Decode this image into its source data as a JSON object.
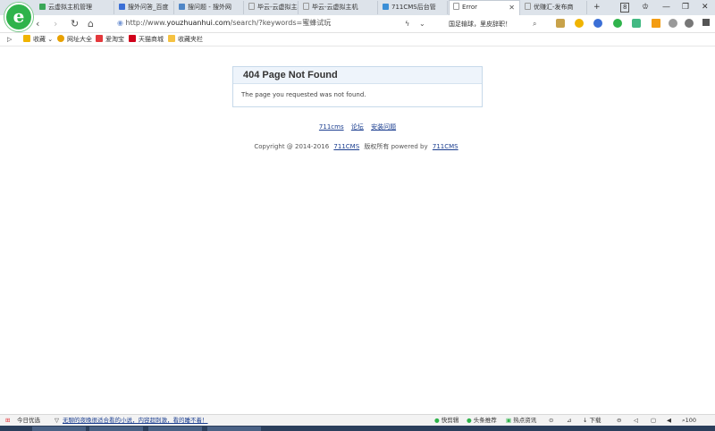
{
  "tabs": [
    {
      "label": "云虚拟主机管理",
      "active": false,
      "color": "#3aa757"
    },
    {
      "label": "搜外问答_百度",
      "active": false,
      "color": "#3b6fd6"
    },
    {
      "label": "搜问题 - 搜外网",
      "active": false,
      "color": "#4f86c6"
    },
    {
      "label": "毕云-云虚拟主机",
      "active": false,
      "color": "#888888"
    },
    {
      "label": "毕云-云虚拟主机",
      "active": false,
      "color": "#888888"
    },
    {
      "label": "711CMS后台管",
      "active": false,
      "color": "#3b8fd6"
    },
    {
      "label": "Error",
      "active": true,
      "color": "#999999"
    },
    {
      "label": "优赚汇-发布商",
      "active": false,
      "color": "#888888"
    }
  ],
  "tab_count": "8",
  "address": {
    "prefix": "http://www.",
    "domain": "youzhuanhui.com",
    "path": "/search/?keywords=蜜蜂试玩"
  },
  "news_ticker": "国足输球，里皮辞职！",
  "bookmarks": [
    {
      "label": "收藏",
      "color": "#f0b400"
    },
    {
      "label": "网址大全",
      "color": "#e8a100"
    },
    {
      "label": "爱淘宝",
      "color": "#e4393c"
    },
    {
      "label": "天猫商城",
      "color": "#d0021b"
    },
    {
      "label": "收藏夹栏",
      "color": "#f5c242"
    }
  ],
  "error": {
    "title": "404 Page Not Found",
    "message": "The page you requested was not found."
  },
  "footer_links": [
    "711cms",
    "论坛",
    "安装问题"
  ],
  "copyright": {
    "prefix": "Copyright @ 2014-2016",
    "brand": "711CMS",
    "middle": "版权所有 powered by",
    "brand2": "711CMS"
  },
  "status": {
    "today": "今日优选",
    "headline": "无聊的夜晚很适合看的小说，内容超刺激，看的睡不着！",
    "items": [
      "快剪辑",
      "头条推荐",
      "热点资讯",
      "下载"
    ],
    "zoom": "100"
  }
}
